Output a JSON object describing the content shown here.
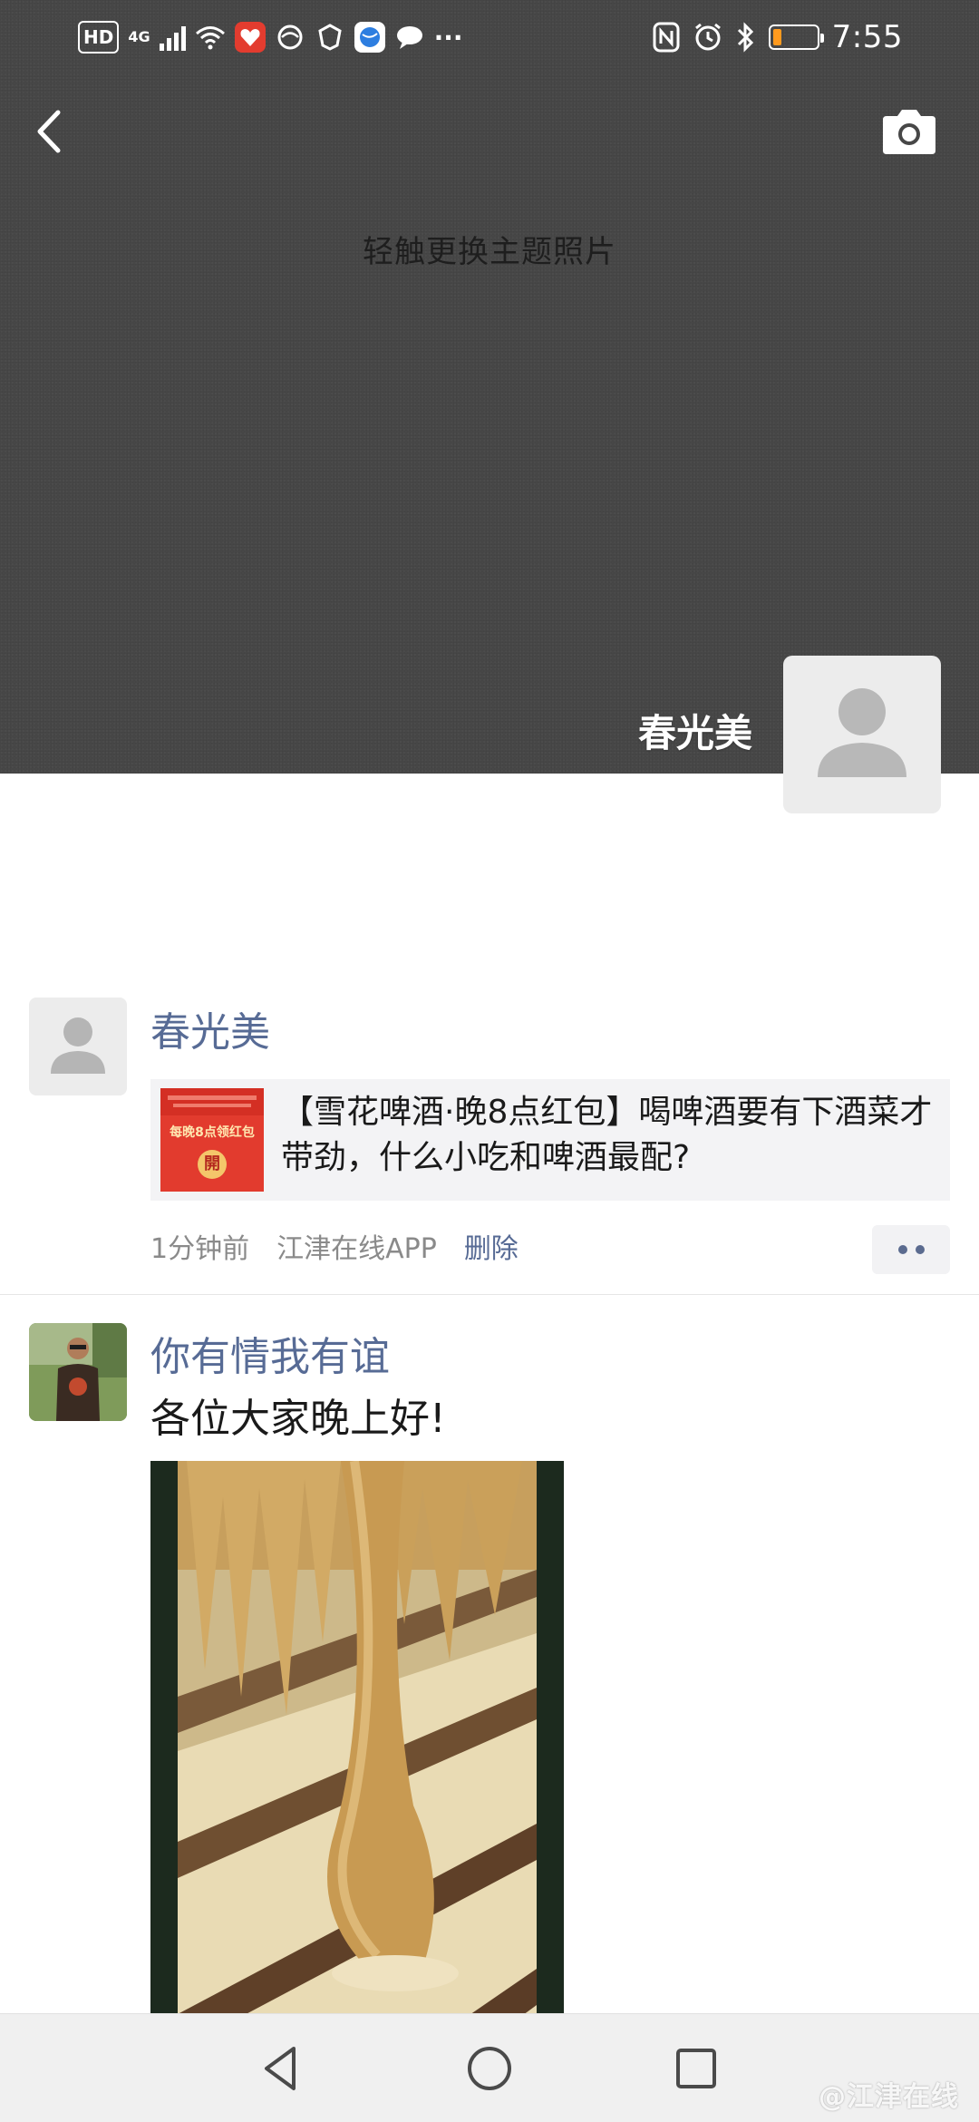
{
  "status_bar": {
    "hd_label": "HD",
    "network_label": "4G",
    "more_label": "···",
    "time": "7:55",
    "battery_color": "#ff9a1e"
  },
  "header": {
    "back_icon": "chevron-left-icon",
    "camera_icon": "camera-icon",
    "cover_hint": "轻触更换主题照片"
  },
  "profile": {
    "name": "春光美"
  },
  "posts": [
    {
      "author": "春光美",
      "share": {
        "thumb_caption": "每晚8点领红包",
        "thumb_button": "開",
        "text": "【雪花啤酒·晚8点红包】喝啤酒要有下酒菜才带劲，什么小吃和啤酒最配?"
      },
      "time": "1分钟前",
      "source": "江津在线APP",
      "delete_label": "删除"
    },
    {
      "author": "你有情我有谊",
      "text": "各位大家晚上好!"
    }
  ],
  "watermark": "@江津在线",
  "colors": {
    "link": "#576b95",
    "cover_bg": "#474747"
  }
}
